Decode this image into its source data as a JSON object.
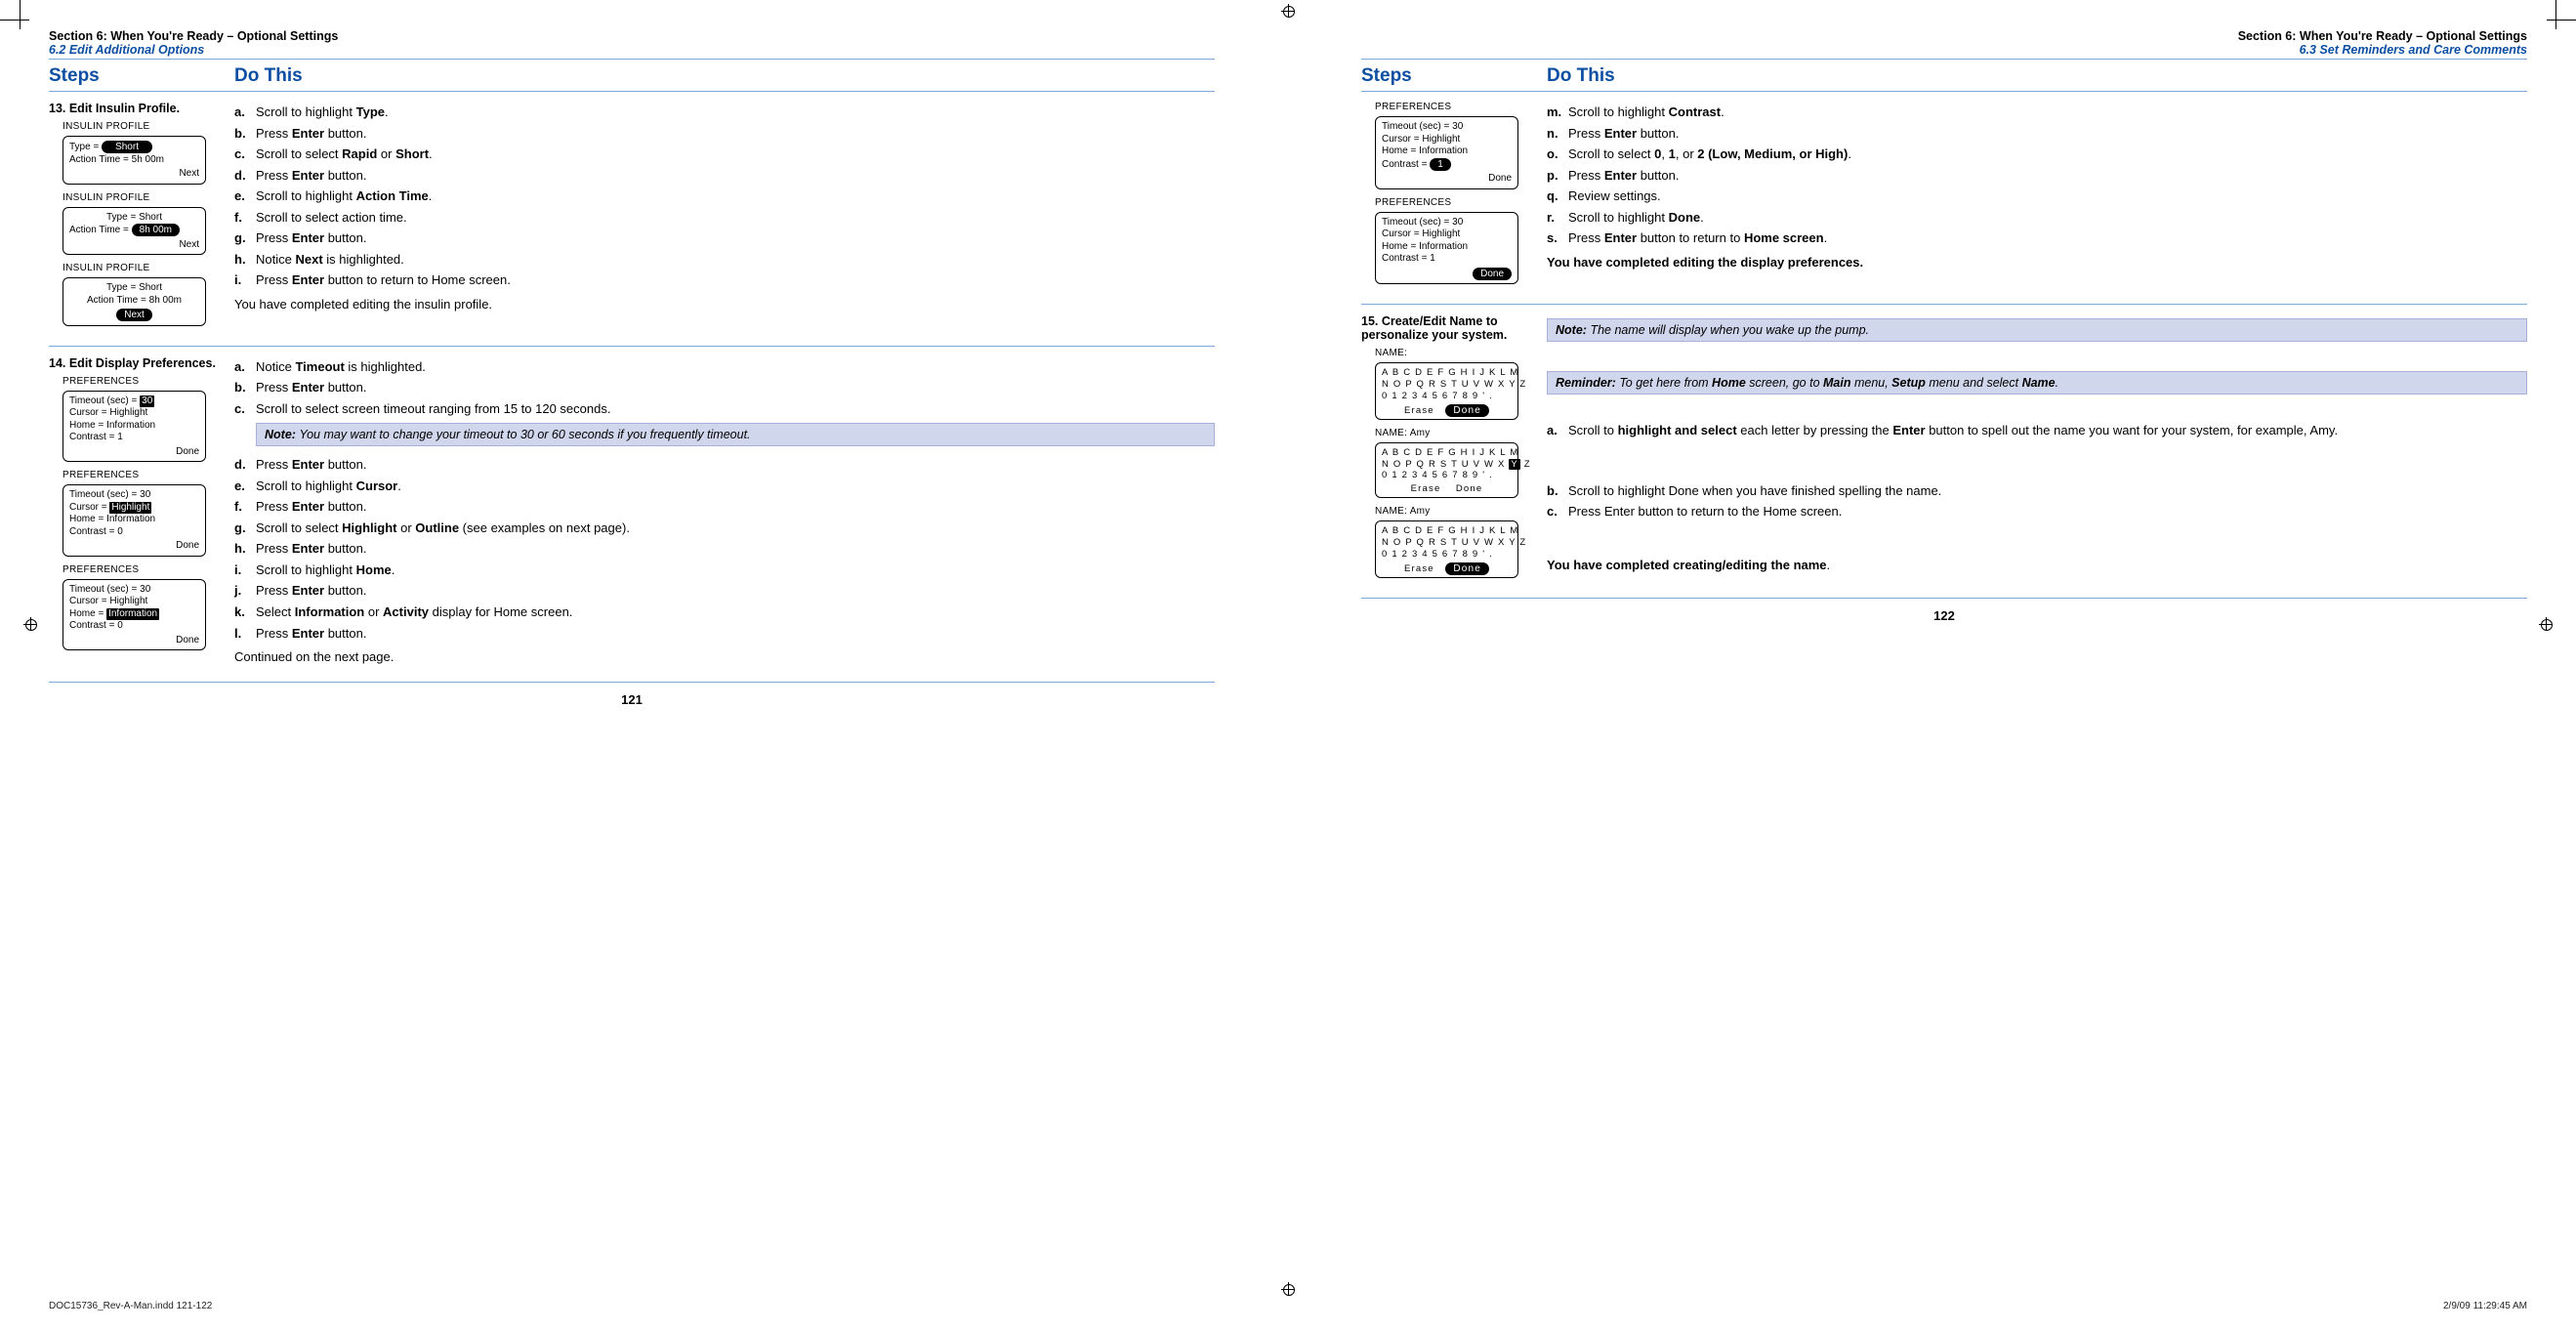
{
  "left": {
    "section": "Section 6: When You're Ready – Optional Settings",
    "subsection": "6.2 Edit Additional Options",
    "steps_head": "Steps",
    "do_head": "Do This",
    "step13": {
      "title": "13. Edit Insulin Profile.",
      "items": {
        "a": "Scroll to highlight <b>Type</b>.",
        "b": "Press <b>Enter</b> button.",
        "c": "Scroll to select <b>Rapid</b> or <b>Short</b>.",
        "d": "Press <b>Enter</b> button.",
        "e": "Scroll to highlight <b>Action Time</b>.",
        "f": "Scroll to select action time.",
        "g": "Press <b>Enter</b> button.",
        "h": "Notice <b>Next</b> is highlighted.",
        "i": "Press <b>Enter</b> button to return to Home screen."
      },
      "completion": "You have completed editing the insulin profile.",
      "screens": {
        "s1_title": "INSULIN PROFILE",
        "s1_l1a": "Type = ",
        "s1_l1b": "Short",
        "s1_l2": "Action Time = 5h 00m",
        "s1_next": "Next",
        "s2_title": "INSULIN PROFILE",
        "s2_l1": "Type = Short",
        "s2_l2a": "Action Time = ",
        "s2_l2b": "8h 00m",
        "s2_next": "Next",
        "s3_title": "INSULIN PROFILE",
        "s3_l1": "Type = Short",
        "s3_l2": "Action Time = 8h 00m",
        "s3_next": "Next"
      }
    },
    "step14": {
      "title": "14. Edit Display Preferences.",
      "items1": {
        "a": "Notice <b>Timeout</b> is highlighted.",
        "b": "Press <b>Enter</b> button.",
        "c": "Scroll to select screen timeout ranging from 15 to 120 seconds."
      },
      "note": "<span class='lead'>Note:</span> <i>You may want to change your timeout to 30 or 60 seconds if you frequently timeout.</i>",
      "items2": {
        "d": "Press <b>Enter</b> button.",
        "e": "Scroll to highlight <b>Cursor</b>.",
        "f": "Press <b>Enter</b> button.",
        "g": "Scroll to select <b>Highlight</b> or <b>Outline</b> (see examples on next page).",
        "h": "Press <b>Enter</b> button.",
        "i": "Scroll to highlight <b>Home</b>.",
        "j": "Press <b>Enter</b> button.",
        "k": "Select <b>Information</b> or <b>Activity</b> display for Home screen.",
        "l": "Press <b>Enter</b> button."
      },
      "continued": "Continued on the next page.",
      "screens": {
        "p_title": "PREFERENCES",
        "s1_l1a": "Timeout (sec) = ",
        "s1_l1b": "30",
        "s1_l2": "Cursor =  Highlight",
        "s1_l3": "Home =  Information",
        "s1_l4": "Contrast =  1",
        "done": "Done",
        "s2_l1": "Timeout (sec) =  30",
        "s2_l2a": "Cursor = ",
        "s2_l2b": "Highlight",
        "s2_l3": "Home =  Information",
        "s2_l4": "Contrast =  0",
        "s3_l1": "Timeout (sec) =  30",
        "s3_l2": "Cursor =  Highlight",
        "s3_l3a": "Home = ",
        "s3_l3b": "Information",
        "s3_l4": "Contrast =  0"
      }
    },
    "page_num": "121"
  },
  "right": {
    "section": "Section 6: When You're Ready – Optional Settings",
    "subsection": "6.3 Set Reminders and Care Comments",
    "steps_head": "Steps",
    "do_head": "Do This",
    "cont": {
      "items": {
        "m": "Scroll to highlight <b>Contrast</b>.",
        "n": "Press <b>Enter</b> button.",
        "o": "Scroll to select <b>0</b>, <b>1</b>, or <b>2 (Low, Medium, or High)</b>.",
        "p": "Press <b>Enter</b> button.",
        "q": "Review settings.",
        "r": "Scroll to highlight <b>Done</b>.",
        "s": "Press <b>Enter</b> button to return to <b>Home screen</b>."
      },
      "completion": "You have completed editing the display preferences.",
      "screens": {
        "p_title": "PREFERENCES",
        "s1_l1": "Timeout (sec) =  30",
        "s1_l2": "Cursor =  Highlight",
        "s1_l3": "Home =  Information",
        "s1_l4a": "Contrast = ",
        "s1_l4b": "1",
        "done": "Done",
        "s2_l1": "Timeout (sec) =  30",
        "s2_l2": "Cursor =  Highlight",
        "s2_l3": "Home =  Information",
        "s2_l4": "Contrast =  1"
      }
    },
    "step15": {
      "title": "15. Create/Edit Name to personalize your system.",
      "note": "<span class='lead'>Note:</span> <i>The name will display when you wake up the pump.</i>",
      "reminder": "<span class='lead'>Reminder:</span> <i>To get here from <b>Home</b> screen, go to <b>Main</b> menu, <b>Setup</b> menu and select <b>Name</b>.</i>",
      "items": {
        "a": "Scroll to <b>highlight and select</b> each letter by pressing the <b>Enter</b> button to spell out the name you want for your system, for example, Amy.",
        "b": "Scroll to highlight Done when you have finished spelling the name.",
        "c": "Press Enter button to return to the Home screen."
      },
      "completion": "<b>You have completed creating/editing the name</b>.",
      "screens": {
        "n1_title": "NAME:",
        "row1": "A B C D E F G H I J K L M",
        "row2": "N O P Q R S T U V W X Y Z",
        "row3": "0 1 2 3 4 5 6 7 8 9   '  .",
        "erase": "Erase",
        "done": "Done",
        "n2_title": "NAME: Amy",
        "row2b_pre": "N O P Q R S T U V W X ",
        "row2b_hl": "Y",
        "row2b_post": " Z",
        "n3_title": "NAME: Amy"
      }
    },
    "page_num": "122"
  },
  "meta": {
    "file": "DOC15736_Rev-A-Man.indd   121-122",
    "stamp": "2/9/09   11:29:45 AM"
  }
}
